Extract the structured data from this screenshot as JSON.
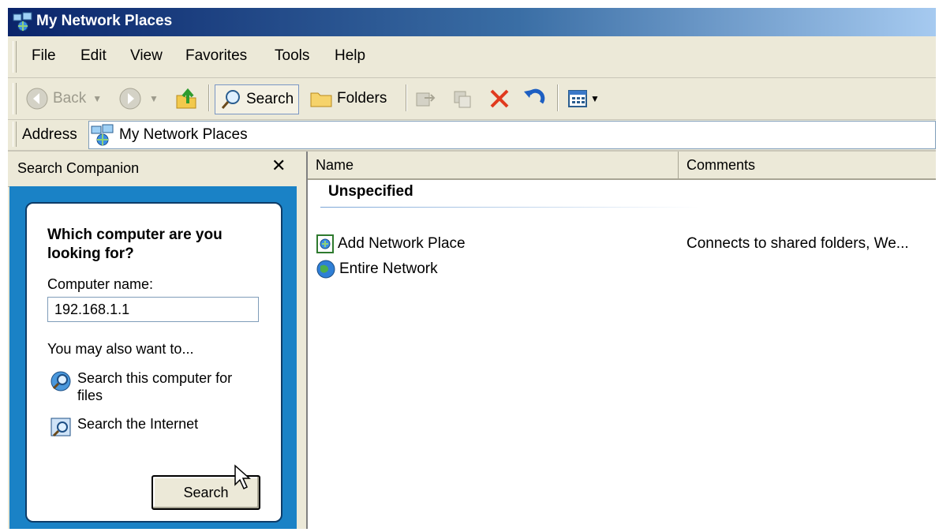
{
  "window": {
    "title": "My Network Places"
  },
  "menu": [
    "File",
    "Edit",
    "View",
    "Favorites",
    "Tools",
    "Help"
  ],
  "toolbar": {
    "back_label": "Back",
    "search_label": "Search",
    "folders_label": "Folders"
  },
  "address": {
    "label": "Address",
    "value": "My Network Places"
  },
  "search_companion": {
    "title": "Search Companion",
    "question": "Which computer are you looking for?",
    "computer_name_label": "Computer name:",
    "computer_name_value": "192.168.1.1",
    "also_text": "You may also want to...",
    "link_search_computer": "Search this computer for files",
    "link_search_internet": "Search the Internet",
    "search_button": "Search"
  },
  "list": {
    "columns": [
      "Name",
      "Comments"
    ],
    "group": "Unspecified",
    "items": [
      {
        "name": "Add Network Place",
        "comment": "Connects to shared folders, We..."
      },
      {
        "name": "Entire Network",
        "comment": ""
      }
    ]
  },
  "colors": {
    "titlebar": "#0a246a",
    "panel_blue": "#1a82c6",
    "chrome": "#ece9d8"
  }
}
